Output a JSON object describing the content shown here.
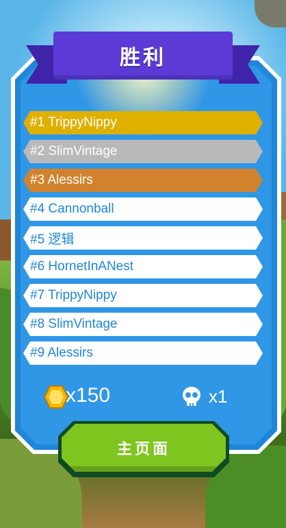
{
  "title": "胜利",
  "leaderboard": [
    {
      "label": "#1 TrippyNippy",
      "tier": "gold"
    },
    {
      "label": "#2 SlimVintage",
      "tier": "silver"
    },
    {
      "label": "#3 Alessirs",
      "tier": "bronze"
    },
    {
      "label": "#4 Cannonball",
      "tier": "plain"
    },
    {
      "label": "#5 逻辑",
      "tier": "plain"
    },
    {
      "label": "#6 HornetInANest",
      "tier": "plain"
    },
    {
      "label": "#7 TrippyNippy",
      "tier": "plain"
    },
    {
      "label": "#8 SlimVintage",
      "tier": "plain"
    },
    {
      "label": "#9 Alessirs",
      "tier": "plain"
    }
  ],
  "stats": {
    "coins": "x150",
    "kills": "x1",
    "coin_icon": "hex-coin-icon",
    "kills_icon": "skull-icon"
  },
  "home_button": {
    "label": "主页面"
  },
  "colors": {
    "gold": "#e0b000",
    "silver": "#b9b9b9",
    "bronze": "#d2822c",
    "panel": "#2f97e6",
    "ribbon": "#5b3ad6",
    "button": "#7ec51f"
  }
}
